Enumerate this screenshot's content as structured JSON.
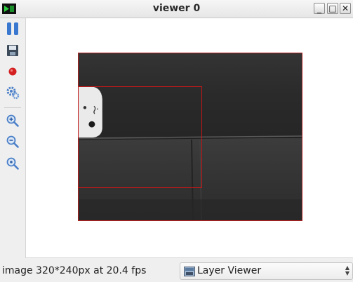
{
  "window": {
    "title": "viewer 0",
    "buttons": {
      "minimize": "_",
      "maximize": "□",
      "close": "✕"
    }
  },
  "toolbar": {
    "tools": [
      {
        "name": "pause",
        "icon": "pause-icon"
      },
      {
        "name": "save",
        "icon": "save-icon"
      },
      {
        "name": "record",
        "icon": "record-icon"
      },
      {
        "name": "settings",
        "icon": "gear-icon"
      },
      {
        "name": "zoom-in",
        "icon": "zoom-in-icon"
      },
      {
        "name": "zoom-out",
        "icon": "zoom-out-icon"
      },
      {
        "name": "zoom-fit",
        "icon": "zoom-reset-icon"
      }
    ]
  },
  "status": {
    "text": "image 320*240px at 20.4 fps"
  },
  "layer_selector": {
    "selected": "Layer Viewer",
    "spinner_up": "▲",
    "spinner_down": "▼"
  },
  "colors": {
    "accent_blue": "#2f6fc7",
    "record_red": "#d42020",
    "roi_red": "#c01818"
  }
}
